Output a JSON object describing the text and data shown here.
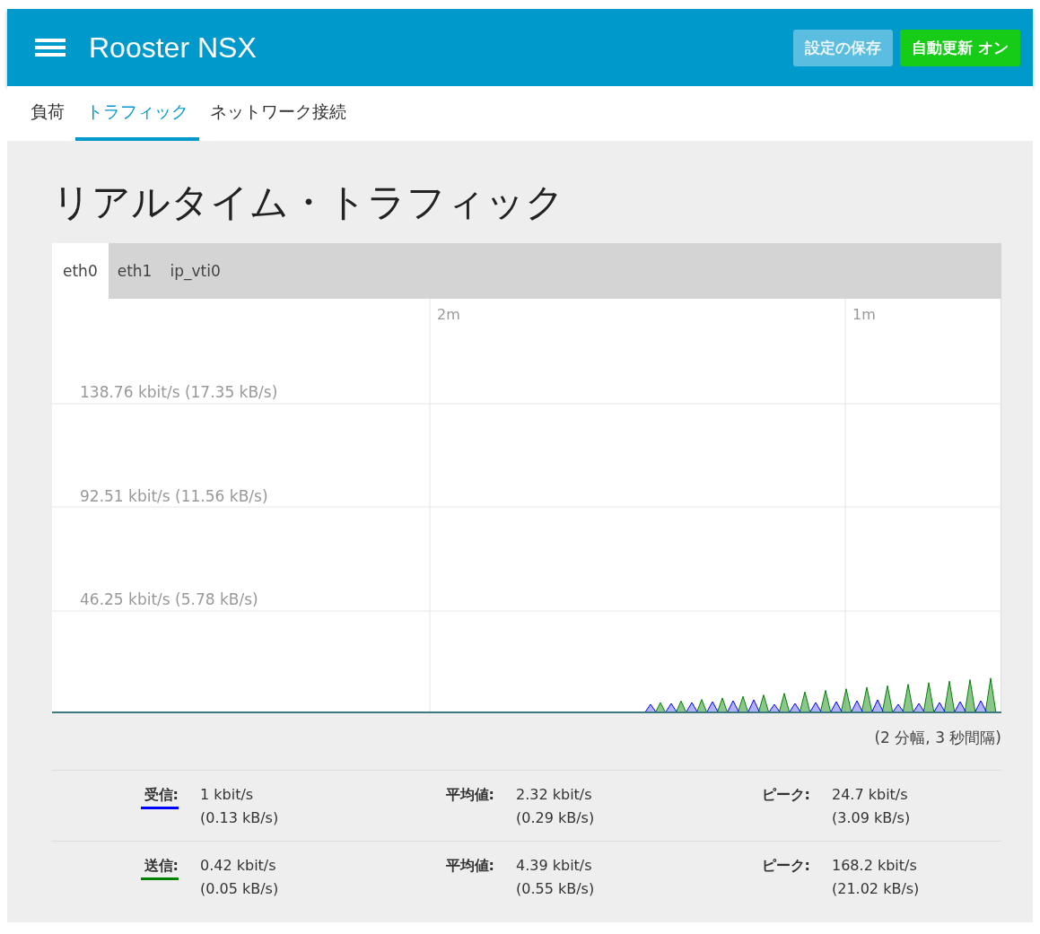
{
  "header": {
    "title": "Rooster NSX",
    "buttons": [
      {
        "label": "設定の保存",
        "kind": "save"
      },
      {
        "label": "自動更新 オン",
        "kind": "toggle"
      }
    ]
  },
  "nav_tabs": [
    {
      "label": "負荷",
      "selected": false
    },
    {
      "label": "トラフィック",
      "selected": true
    },
    {
      "label": "ネットワーク接続",
      "selected": false
    }
  ],
  "heading": "リアルタイム・トラフィック",
  "interface_tabs": [
    {
      "label": "eth0",
      "selected": true
    },
    {
      "label": "eth1",
      "selected": false
    },
    {
      "label": "ip_vti0",
      "selected": false
    }
  ],
  "graph": {
    "time_labels": [
      "2m",
      "1m"
    ],
    "rate_labels": [
      "138.76 kbit/s (17.35 kB/s)",
      "92.51 kbit/s (11.56 kB/s)",
      "46.25 kbit/s (5.78 kB/s)"
    ],
    "note": "(2 分幅, 3 秒間隔)"
  },
  "stats": [
    {
      "label": "受信:",
      "color": "#0000ff",
      "current": [
        "1 kbit/s",
        "(0.13 kB/s)"
      ],
      "average_label": "平均値:",
      "average": [
        "2.32 kbit/s",
        "(0.29 kB/s)"
      ],
      "peak_label": "ピーク:",
      "peak": [
        "24.7 kbit/s",
        "(3.09 kB/s)"
      ]
    },
    {
      "label": "送信:",
      "color": "#008000",
      "current": [
        "0.42 kbit/s",
        "(0.05 kB/s)"
      ],
      "average_label": "平均値:",
      "average": [
        "4.39 kbit/s",
        "(0.55 kB/s)"
      ],
      "peak_label": "ピーク:",
      "peak": [
        "168.2 kbit/s",
        "(21.02 kB/s)"
      ]
    }
  ]
}
